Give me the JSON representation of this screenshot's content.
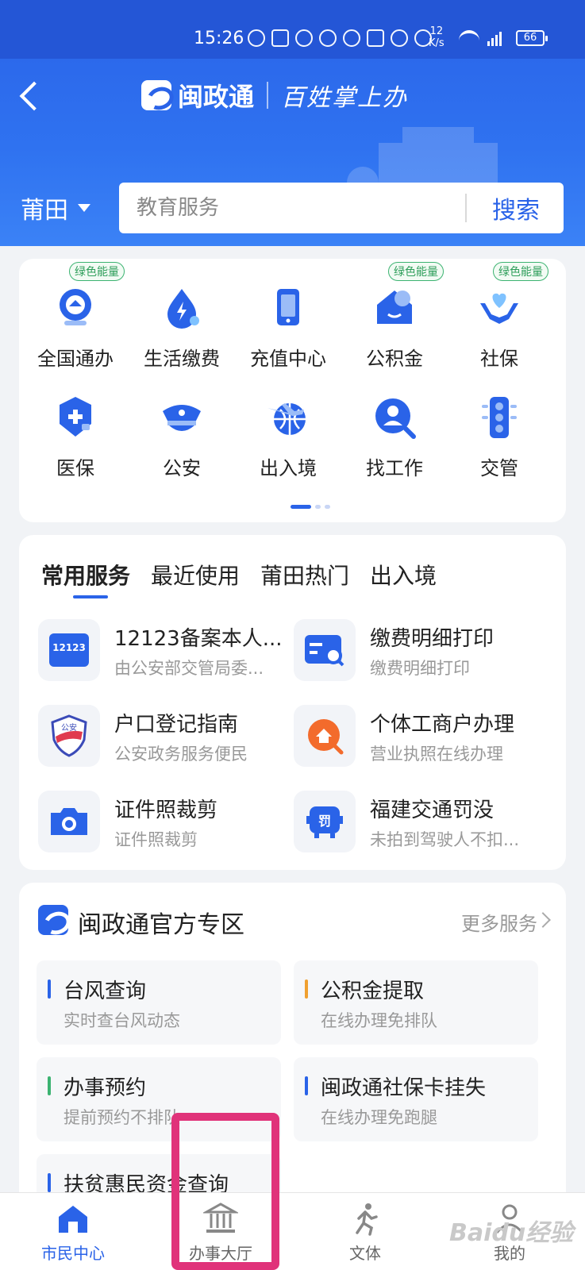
{
  "status_bar": {
    "time": "15:26",
    "speed_value": "12",
    "speed_unit": "K/s",
    "battery": "66"
  },
  "header": {
    "app_name": "闽政通",
    "slogan": "百姓掌上办"
  },
  "location": {
    "city": "莆田"
  },
  "search": {
    "placeholder": "教育服务",
    "button_label": "搜索"
  },
  "quick_grid": {
    "badge_label": "绿色能量",
    "items": [
      {
        "label": "全国通办",
        "icon": "national-service-icon",
        "badge": true
      },
      {
        "label": "生活缴费",
        "icon": "utility-payment-icon",
        "badge": false
      },
      {
        "label": "充值中心",
        "icon": "phone-recharge-icon",
        "badge": false
      },
      {
        "label": "公积金",
        "icon": "housing-fund-icon",
        "badge": true
      },
      {
        "label": "社保",
        "icon": "social-security-icon",
        "badge": true
      },
      {
        "label": "医保",
        "icon": "medical-insurance-icon",
        "badge": false
      },
      {
        "label": "公安",
        "icon": "police-cap-icon",
        "badge": false
      },
      {
        "label": "出入境",
        "icon": "globe-plane-icon",
        "badge": false
      },
      {
        "label": "找工作",
        "icon": "job-search-icon",
        "badge": false
      },
      {
        "label": "交管",
        "icon": "traffic-light-icon",
        "badge": false
      }
    ]
  },
  "services": {
    "tabs": [
      "常用服务",
      "最近使用",
      "莆田热门",
      "出入境"
    ],
    "active_tab": 0,
    "items": [
      {
        "title": "12123备案本人...",
        "subtitle": "由公安部交管局委...",
        "icon": "12123-app-icon",
        "icon_text": "12123"
      },
      {
        "title": "缴费明细打印",
        "subtitle": "缴费明细打印",
        "icon": "payment-detail-icon"
      },
      {
        "title": "户口登记指南",
        "subtitle": "公安政务服务便民",
        "icon": "police-shield-icon",
        "icon_text": "公安"
      },
      {
        "title": "个体工商户办理",
        "subtitle": "营业执照在线办理",
        "icon": "business-license-icon"
      },
      {
        "title": "证件照裁剪",
        "subtitle": "证件照裁剪",
        "icon": "camera-icon"
      },
      {
        "title": "福建交通罚没",
        "subtitle": "未拍到驾驶人不扣...",
        "icon": "traffic-fine-icon",
        "icon_text": "罚"
      }
    ]
  },
  "official_zone": {
    "title": "闽政通官方专区",
    "more_label": "更多服务",
    "items": [
      {
        "title": "台风查询",
        "subtitle": "实时查台风动态",
        "accent": "#2a63e8"
      },
      {
        "title": "公积金提取",
        "subtitle": "在线办理免排队",
        "accent": "#f0a030"
      },
      {
        "title": "办事预约",
        "subtitle": "提前预约不排队",
        "accent": "#3cb371"
      },
      {
        "title": "闽政通社保卡挂失",
        "subtitle": "在线办理免跑腿",
        "accent": "#2a63e8"
      },
      {
        "title": "扶贫惠民资金查询",
        "subtitle": "",
        "accent": "#2a63e8"
      }
    ]
  },
  "bottom_nav": {
    "items": [
      {
        "label": "市民中心",
        "icon": "home-icon",
        "active": true
      },
      {
        "label": "办事大厅",
        "icon": "hall-building-icon",
        "active": false
      },
      {
        "label": "文体",
        "icon": "running-person-icon",
        "active": false
      },
      {
        "label": "我的",
        "icon": "user-icon",
        "active": false
      }
    ]
  },
  "watermark": "Baidu经验",
  "colors": {
    "primary": "#2a63e8",
    "highlight_box": "#e0337a",
    "badge_green": "#2e9e5a"
  }
}
